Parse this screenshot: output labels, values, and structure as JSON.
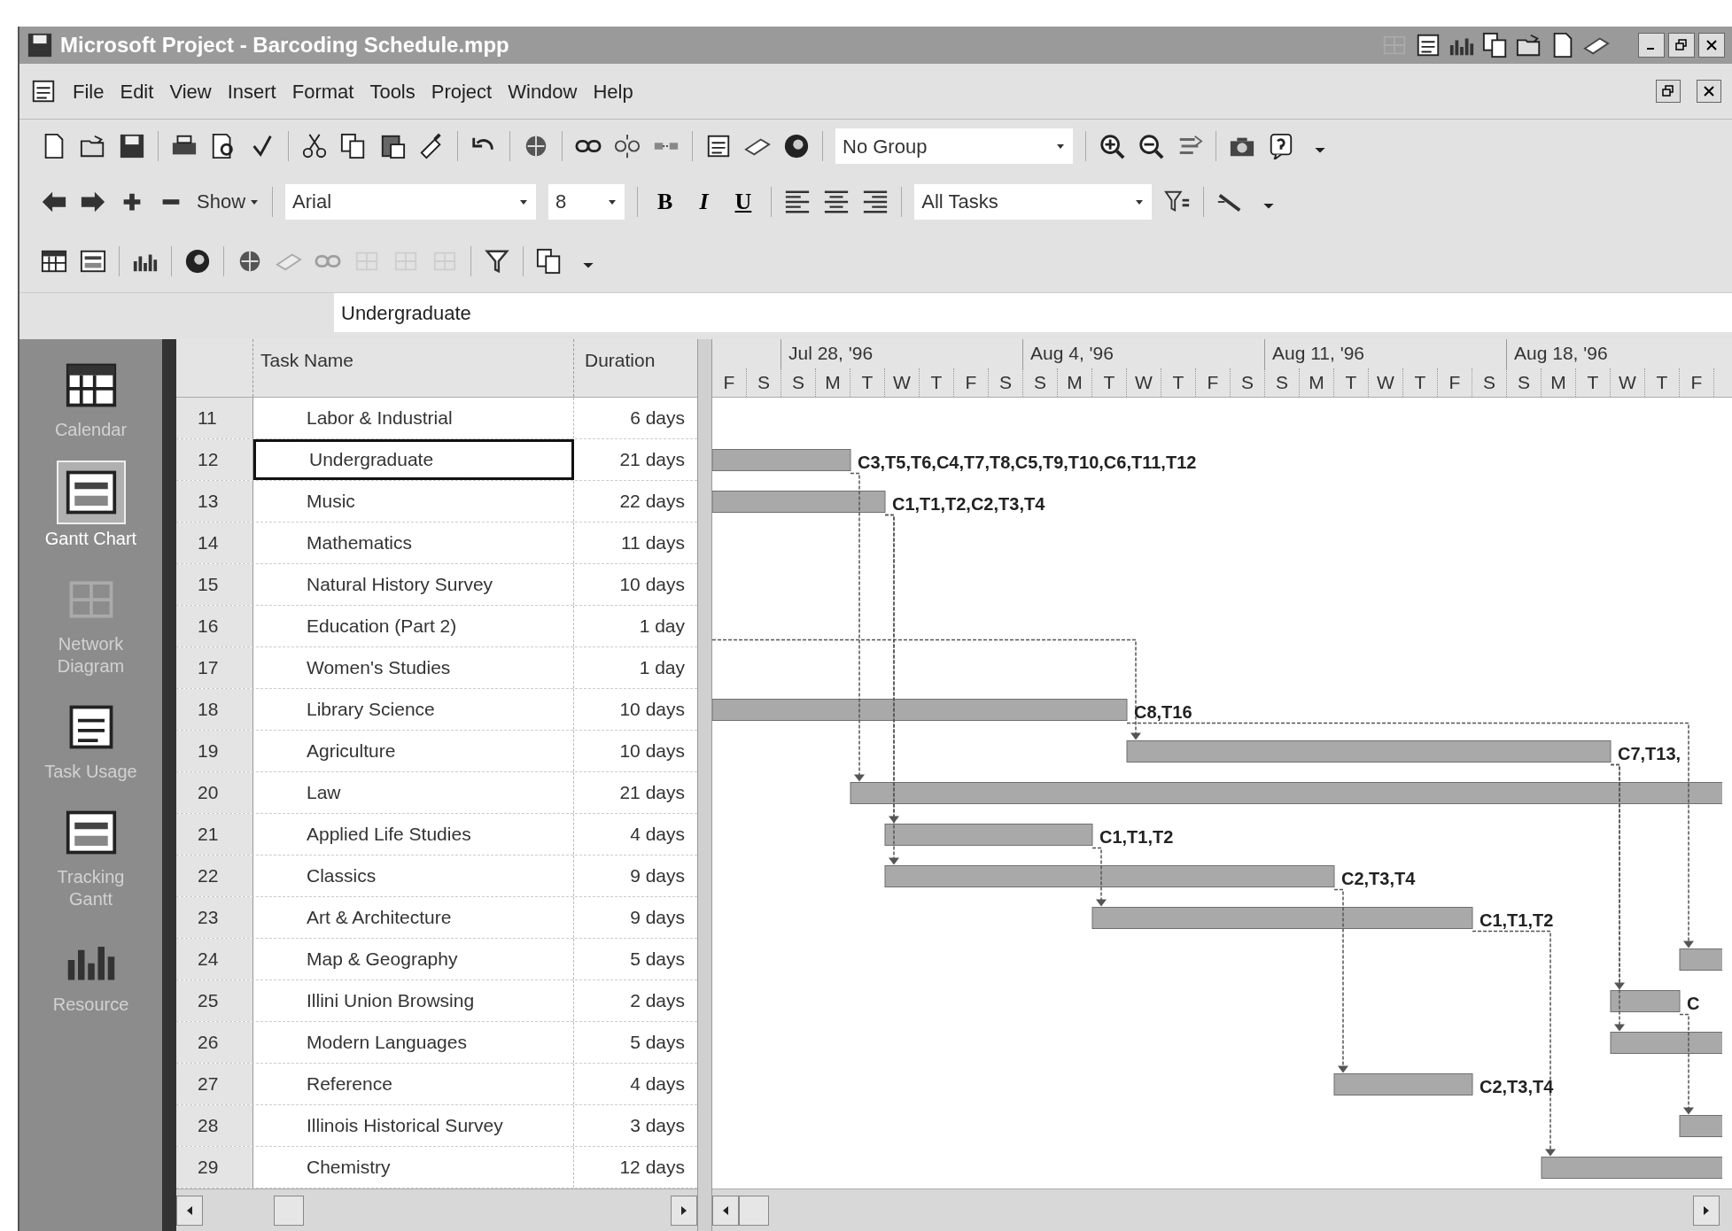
{
  "window": {
    "title": "Microsoft Project - Barcoding Schedule.mpp"
  },
  "menu": [
    "File",
    "Edit",
    "View",
    "Insert",
    "Format",
    "Tools",
    "Project",
    "Window",
    "Help"
  ],
  "toolbars": {
    "group": "No Group",
    "show": "Show",
    "font": "Arial",
    "size": "8",
    "bold": "B",
    "italic": "I",
    "underline": "U",
    "filter": "All Tasks"
  },
  "entry_bar": {
    "value": "Undergraduate"
  },
  "view_bar": [
    {
      "label": "Calendar",
      "selected": false
    },
    {
      "label": "Gantt Chart",
      "selected": true
    },
    {
      "label": "Network Diagram",
      "selected": false
    },
    {
      "label": "Task Usage",
      "selected": false
    },
    {
      "label": "Tracking Gantt",
      "selected": false
    },
    {
      "label": "Resource",
      "selected": false
    }
  ],
  "table": {
    "columns": [
      "Task Name",
      "Duration"
    ],
    "rows": [
      {
        "id": "11",
        "name": "Labor & Industrial",
        "duration": "6 days",
        "selected": false
      },
      {
        "id": "12",
        "name": "Undergraduate",
        "duration": "21 days",
        "selected": true,
        "bar_label": "C3,T5,T6,C4,T7,T8,C5,T9,T10,C6,T11,T12"
      },
      {
        "id": "13",
        "name": "Music",
        "duration": "22 days",
        "selected": false,
        "bar_label": "C1,T1,T2,C2,T3,T4"
      },
      {
        "id": "14",
        "name": "Mathematics",
        "duration": "11 days",
        "selected": false
      },
      {
        "id": "15",
        "name": "Natural History Survey",
        "duration": "10 days",
        "selected": false
      },
      {
        "id": "16",
        "name": "Education (Part 2)",
        "duration": "1 day",
        "selected": false
      },
      {
        "id": "17",
        "name": "Women's Studies",
        "duration": "1 day",
        "selected": false
      },
      {
        "id": "18",
        "name": "Library Science",
        "duration": "10 days",
        "selected": false,
        "bar_label": "C8,T16"
      },
      {
        "id": "19",
        "name": "Agriculture",
        "duration": "10 days",
        "selected": false,
        "bar_label": "C7,T13,"
      },
      {
        "id": "20",
        "name": "Law",
        "duration": "21 days",
        "selected": false
      },
      {
        "id": "21",
        "name": "Applied Life Studies",
        "duration": "4 days",
        "selected": false,
        "bar_label": "C1,T1,T2"
      },
      {
        "id": "22",
        "name": "Classics",
        "duration": "9 days",
        "selected": false,
        "bar_label": "C2,T3,T4"
      },
      {
        "id": "23",
        "name": "Art & Architecture",
        "duration": "9 days",
        "selected": false,
        "bar_label": "C1,T1,T2"
      },
      {
        "id": "24",
        "name": "Map & Geography",
        "duration": "5 days",
        "selected": false
      },
      {
        "id": "25",
        "name": "Illini Union Browsing",
        "duration": "2 days",
        "selected": false,
        "bar_label": "C"
      },
      {
        "id": "26",
        "name": "Modern Languages",
        "duration": "5 days",
        "selected": false
      },
      {
        "id": "27",
        "name": "Reference",
        "duration": "4 days",
        "selected": false,
        "bar_label": "C2,T3,T4"
      },
      {
        "id": "28",
        "name": "Illinois Historical Survey",
        "duration": "3 days",
        "selected": false
      },
      {
        "id": "29",
        "name": "Chemistry",
        "duration": "12 days",
        "selected": false
      }
    ]
  },
  "timescale": {
    "weeks": [
      "Jul 28, '96",
      "Aug 4, '96",
      "Aug 11, '96",
      "Aug 18, '96"
    ],
    "days": [
      "F",
      "S",
      "S",
      "M",
      "T",
      "W",
      "T",
      "F",
      "S",
      "S",
      "M",
      "T",
      "W",
      "T",
      "F",
      "S",
      "S",
      "M",
      "T",
      "W",
      "T",
      "F",
      "S",
      "S",
      "M",
      "T",
      "W",
      "T",
      "F"
    ]
  }
}
